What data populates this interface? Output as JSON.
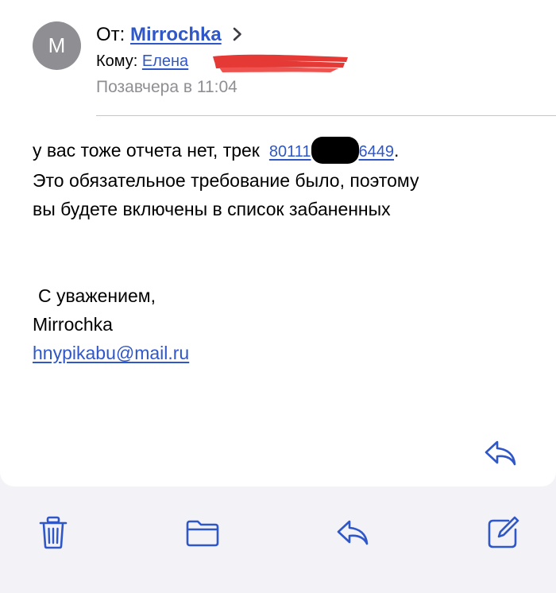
{
  "header": {
    "avatar_initial": "M",
    "from_label": "От:",
    "sender_name": "Mirrochka",
    "to_label": "Кому:",
    "recipient_name": "Елена",
    "date": "Позавчера в 11:04"
  },
  "message": {
    "line1_prefix": "у вас тоже отчета нет, трек",
    "track_visible_start": "80111",
    "track_visible_end": "6449",
    "line1_suffix": ".",
    "line2": "Это обязательное требование было, поэтому",
    "line3": "вы будете включены в список забаненных",
    "signature_greeting": "С уважением,",
    "signature_name": "Mirrochka",
    "signature_email": "hnypikabu@mail.ru"
  },
  "icons": {
    "avatar": "avatar-initial",
    "sender_chevron": "chevron-right-icon",
    "inline_reply": "reply-icon",
    "toolbar": [
      "trash-icon",
      "folder-icon",
      "reply-icon",
      "compose-icon"
    ]
  },
  "colors": {
    "accent": "#2f57c8",
    "secondary_text": "#8e8e93",
    "avatar_bg": "#8e8e93",
    "redaction_red": "#e53935",
    "background": "#f2f2f7",
    "card": "#ffffff"
  }
}
